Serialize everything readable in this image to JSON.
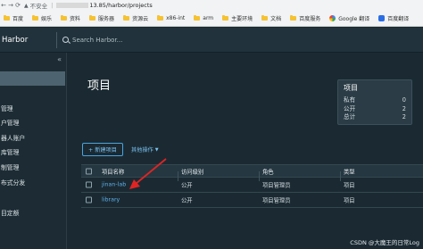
{
  "browser": {
    "security_label": "不安全",
    "url_tail": "13.85/harbor/projects",
    "bookmarks": [
      {
        "label": "百度",
        "icon": "folder-icon"
      },
      {
        "label": "娱乐",
        "icon": "folder-icon"
      },
      {
        "label": "资料",
        "icon": "folder-icon"
      },
      {
        "label": "服务器",
        "icon": "folder-icon"
      },
      {
        "label": "资源云",
        "icon": "folder-icon"
      },
      {
        "label": "x86-int",
        "icon": "folder-icon"
      },
      {
        "label": "arm",
        "icon": "folder-icon"
      },
      {
        "label": "主要环境",
        "icon": "folder-icon"
      },
      {
        "label": "文档",
        "icon": "folder-icon"
      },
      {
        "label": "百度服务",
        "icon": "folder-icon"
      },
      {
        "label": "Google 翻译",
        "icon": "google-icon"
      },
      {
        "label": "百度翻译",
        "icon": "baidu-icon"
      }
    ]
  },
  "header": {
    "brand": "Harbor",
    "search_placeholder": "Search Harbor..."
  },
  "sidebar": {
    "collapse": "«",
    "items": [
      "管理",
      "户管理",
      "器人账户",
      "库管理",
      "制管理",
      "布式分发",
      "目定额"
    ]
  },
  "main": {
    "title": "项目",
    "summary": {
      "title": "项目",
      "rows": [
        {
          "label": "私有",
          "value": "0"
        },
        {
          "label": "公开",
          "value": "2"
        },
        {
          "label": "总计",
          "value": "2"
        }
      ]
    },
    "new_project_button": "+ 新建项目",
    "more_actions": "其他操作",
    "table": {
      "headers": [
        "项目名称",
        "访问级别",
        "角色",
        "类型"
      ],
      "rows": [
        {
          "name": "jinan-lab",
          "access": "公开",
          "role": "项目管理员",
          "type": "项目"
        },
        {
          "name": "library",
          "access": "公开",
          "role": "项目管理员",
          "type": "项目"
        }
      ]
    }
  },
  "watermark": "CSDN @大魔王的日常Log",
  "colors": {
    "accent": "#4aa3df",
    "annotation_arrow": "#e02424",
    "background": "#1b2a32"
  }
}
